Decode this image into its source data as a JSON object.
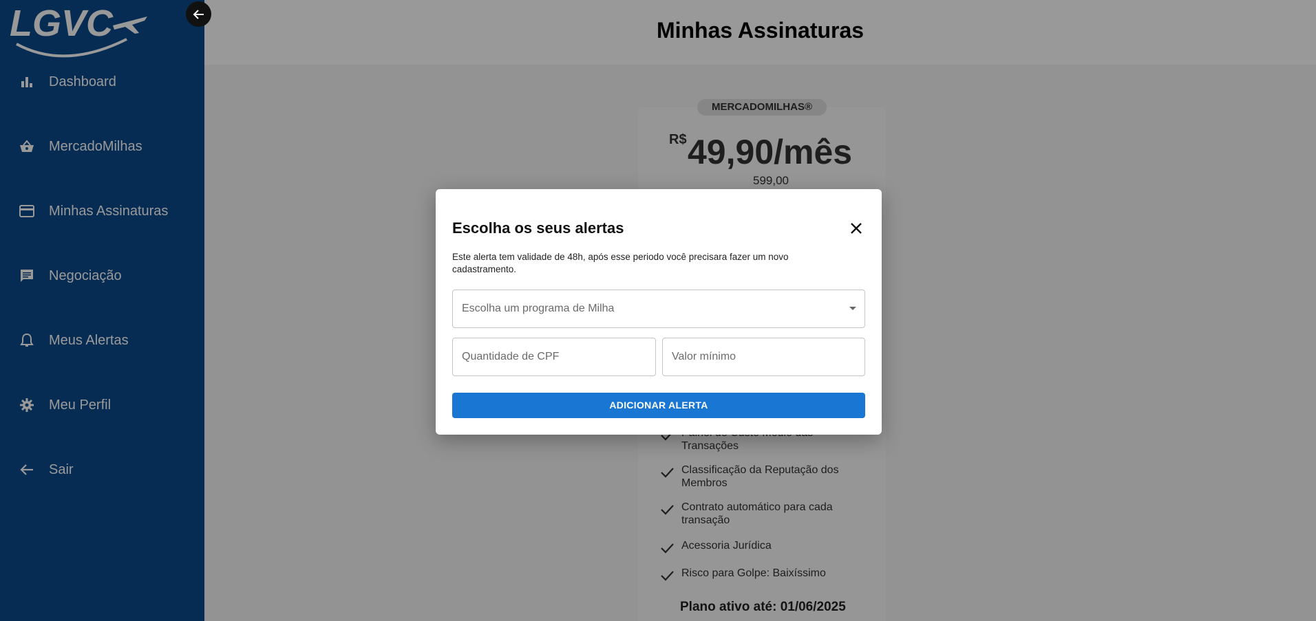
{
  "brand": {
    "logo_text": "LGVC"
  },
  "sidebar": {
    "items": [
      {
        "label": "Dashboard",
        "icon": "bar-chart-icon"
      },
      {
        "label": "MercadoMilhas",
        "icon": "basket-icon"
      },
      {
        "label": "Minhas Assinaturas",
        "icon": "credit-card-icon"
      },
      {
        "label": "Negociação",
        "icon": "chat-icon"
      },
      {
        "label": "Meus Alertas",
        "icon": "bell-icon"
      },
      {
        "label": "Meu Perfil",
        "icon": "gear-icon"
      },
      {
        "label": "Sair",
        "icon": "arrow-left-icon"
      }
    ]
  },
  "header": {
    "title": "Minhas Assinaturas"
  },
  "plan_card": {
    "badge": "MERCADOMILHAS®",
    "currency": "R$",
    "price": "49,90/mês",
    "old_price": "599,00",
    "features": [
      "Painel de Custo Médio das Transações",
      "Classificação da Reputação dos Membros",
      "Contrato automático para cada transação",
      "Acessoria Jurídica",
      "Risco para Golpe: Baixíssimo"
    ],
    "active_until": "Plano ativo até: 01/06/2025"
  },
  "modal": {
    "title": "Escolha os seus alertas",
    "description": "Este alerta tem validade de 48h, após esse periodo você precisara fazer um novo cadastramento.",
    "program_placeholder": "Escolha um programa de Milha",
    "cpf_placeholder": "Quantidade de CPF",
    "min_value_placeholder": "Valor mínimo",
    "submit_label": "ADICIONAR ALERTA"
  },
  "colors": {
    "sidebar_bg": "#0b4a8c",
    "primary_button": "#1976d2"
  }
}
